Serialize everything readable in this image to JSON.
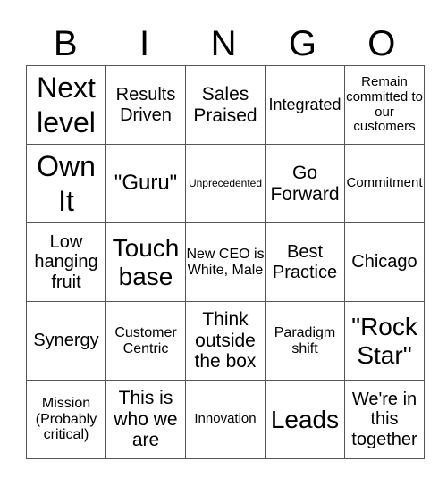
{
  "header": [
    "B",
    "I",
    "N",
    "G",
    "O"
  ],
  "cells": [
    [
      "Next level",
      "Results Driven",
      "Sales Praised",
      "Integrated",
      "Remain committed to our customers"
    ],
    [
      "Own It",
      "\"Guru\"",
      "Unprecedented",
      "Go Forward",
      "Commitment"
    ],
    [
      "Low hanging fruit",
      "Touch base",
      "New CEO is White, Male",
      "Best Practice",
      "Chicago"
    ],
    [
      "Synergy",
      "Customer Centric",
      "Think outside the box",
      "Paradigm shift",
      "\"Rock Star\""
    ],
    [
      "Mission (Probably critical)",
      "This is who we are",
      "Innovation",
      "Leads",
      "We're in this together"
    ]
  ]
}
